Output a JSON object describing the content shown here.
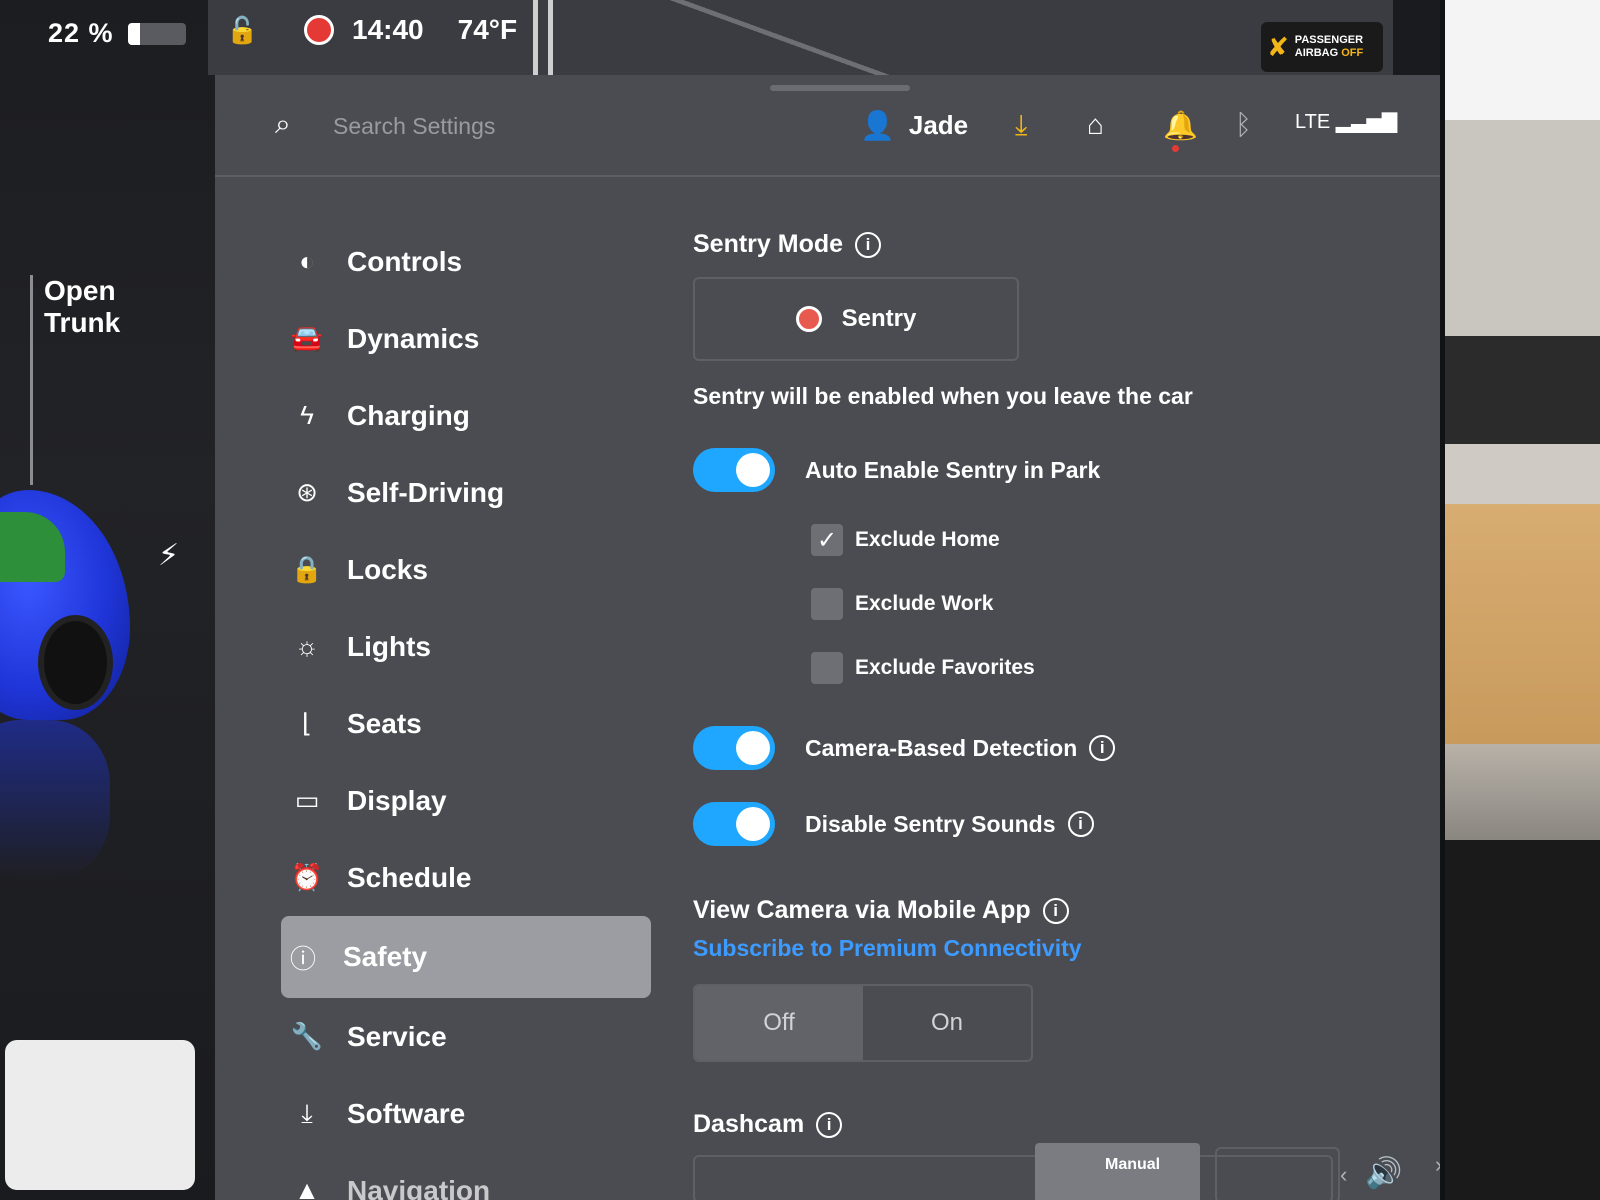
{
  "status": {
    "battery_pct": "22 %",
    "battery_level": 0.22,
    "time": "14:40",
    "temperature": "74°F",
    "airbag_line1": "PASSENGER",
    "airbag_line2": "AIRBAG",
    "airbag_line3": "OFF"
  },
  "car": {
    "open_trunk": "Open\nTrunk"
  },
  "topbar": {
    "search_placeholder": "Search Settings",
    "profile_name": "Jade",
    "lte_label": "LTE"
  },
  "sidebar": {
    "items": [
      {
        "label": "Controls",
        "icon": "toggle-icon"
      },
      {
        "label": "Dynamics",
        "icon": "car-icon"
      },
      {
        "label": "Charging",
        "icon": "bolt-icon"
      },
      {
        "label": "Self-Driving",
        "icon": "steering-wheel-icon"
      },
      {
        "label": "Locks",
        "icon": "lock-icon"
      },
      {
        "label": "Lights",
        "icon": "sun-icon"
      },
      {
        "label": "Seats",
        "icon": "seat-icon"
      },
      {
        "label": "Display",
        "icon": "display-icon"
      },
      {
        "label": "Schedule",
        "icon": "alarm-clock-icon"
      },
      {
        "label": "Safety",
        "icon": "alert-circle-icon",
        "active": true
      },
      {
        "label": "Service",
        "icon": "wrench-icon"
      },
      {
        "label": "Software",
        "icon": "download-icon"
      },
      {
        "label": "Navigation",
        "icon": "navigation-icon"
      }
    ]
  },
  "content": {
    "sentry_mode_title": "Sentry Mode",
    "sentry_button_label": "Sentry",
    "sentry_note": "Sentry will be enabled when you leave the car",
    "auto_enable_label": "Auto Enable Sentry in Park",
    "auto_enable_on": true,
    "exclude_home": "Exclude Home",
    "exclude_home_checked": true,
    "exclude_work": "Exclude Work",
    "exclude_work_checked": false,
    "exclude_favorites": "Exclude Favorites",
    "exclude_favorites_checked": false,
    "camera_detection_label": "Camera-Based Detection",
    "camera_detection_on": true,
    "disable_sounds_label": "Disable Sentry Sounds",
    "disable_sounds_on": true,
    "view_camera_title": "View Camera via Mobile App",
    "subscribe_link": "Subscribe to Premium Connectivity",
    "view_camera_off": "Off",
    "view_camera_on": "On",
    "view_camera_selected": "Off",
    "dashcam_title": "Dashcam"
  },
  "bottom": {
    "manual_label": "Manual"
  },
  "colors": {
    "accent_blue": "#1fa7ff",
    "link_blue": "#3d9bff",
    "record_red": "#e53935",
    "warning_yellow": "#f2b619",
    "panel_gray": "#4b4c51"
  }
}
